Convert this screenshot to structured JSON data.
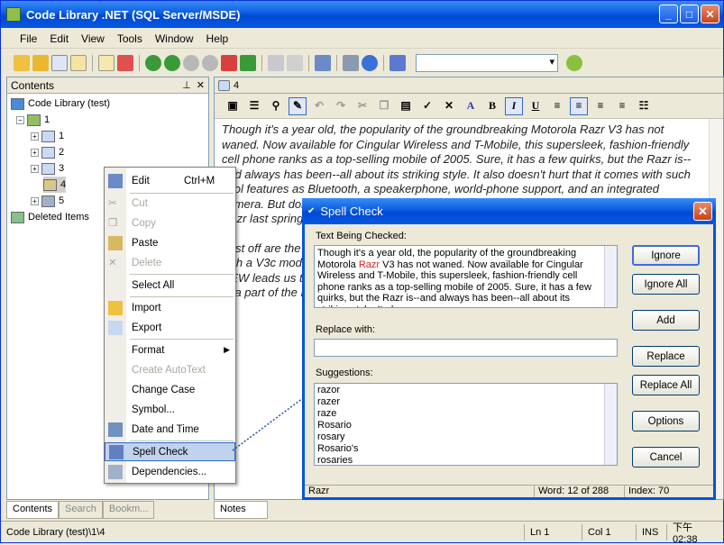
{
  "app": {
    "title": "Code Library .NET (SQL Server/MSDE)"
  },
  "menu": [
    "File",
    "Edit",
    "View",
    "Tools",
    "Window",
    "Help"
  ],
  "left_panel": {
    "header": "Contents",
    "tree": {
      "root": "Code Library (test)",
      "group": "1",
      "children": [
        "1",
        "2",
        "3",
        "4",
        "5"
      ],
      "deleted": "Deleted Items"
    },
    "tabs": [
      "Contents",
      "Search",
      "Bookm..."
    ]
  },
  "doc": {
    "tab": "4",
    "notes_tab": "Notes",
    "paragraphs": [
      "Though it's a year old, the popularity of the groundbreaking Motorola Razr V3 has not waned. Now available for Cingular Wireless and T-Mobile, this supersleek, fashion-friendly cell phone ranks as a top-selling mobile of 2005. Sure, it has a few quirks, but the Razr is--and always has been--all about its striking style. It also doesn't hurt that it comes with such cool features as Bluetooth, a speakerphone, world-phone support, and an integrated camera. But don't think the company is satisfied with its success. After introducing the black Razr last spring, Motorola launched the pink Razr V3 exclusively for T-Mobile this handset.",
      "First off are the new colors in the Razr lineup, including a few little more to the Razr family with a V3c model, the Motorola Razr V3i, a ball for the pastel crowd, and the V3 player. The NEW leads us to the RAZR V3i variety include support the death knell for this is a 3G GSM ... a part of the RAZR family"
    ]
  },
  "context_menu": {
    "items": [
      {
        "label": "Edit",
        "shortcut": "Ctrl+M"
      },
      {
        "label": "Cut"
      },
      {
        "label": "Copy"
      },
      {
        "label": "Paste"
      },
      {
        "label": "Delete"
      },
      {
        "label": "Select All"
      },
      {
        "label": "Import"
      },
      {
        "label": "Export"
      },
      {
        "label": "Format"
      },
      {
        "label": "Create AutoText"
      },
      {
        "label": "Change Case"
      },
      {
        "label": "Symbol..."
      },
      {
        "label": "Date and Time"
      },
      {
        "label": "Spell Check"
      },
      {
        "label": "Dependencies..."
      }
    ]
  },
  "spell": {
    "title": "Spell Check",
    "checking_label": "Text Being Checked:",
    "checking_pre": "Though it's a year old, the popularity of the groundbreaking Motorola ",
    "checking_word": "Razr",
    "checking_post": " V3 has not waned. Now available for Cingular Wireless and T-Mobile, this supersleek, fashion-friendly cell phone ranks as a top-selling mobile of 2005. Sure, it has a few quirks, but the Razr is--and always has been--all about its striking style. It also",
    "replace_label": "Replace with:",
    "replace_value": "",
    "suggestions_label": "Suggestions:",
    "suggestions": [
      "razor",
      "razer",
      "raze",
      "Rosario",
      "rosary",
      "Rosario's",
      "rosaries"
    ],
    "buttons": [
      "Ignore",
      "Ignore All",
      "Add",
      "Replace",
      "Replace All",
      "Options",
      "Cancel"
    ],
    "status": {
      "word": "Razr",
      "count": "Word: 12 of 288",
      "index": "Index: 70"
    }
  },
  "status": {
    "path": "Code Library (test)\\1\\4",
    "ln": "Ln 1",
    "col": "Col 1",
    "ins": "INS",
    "time": "下午 02:38"
  }
}
